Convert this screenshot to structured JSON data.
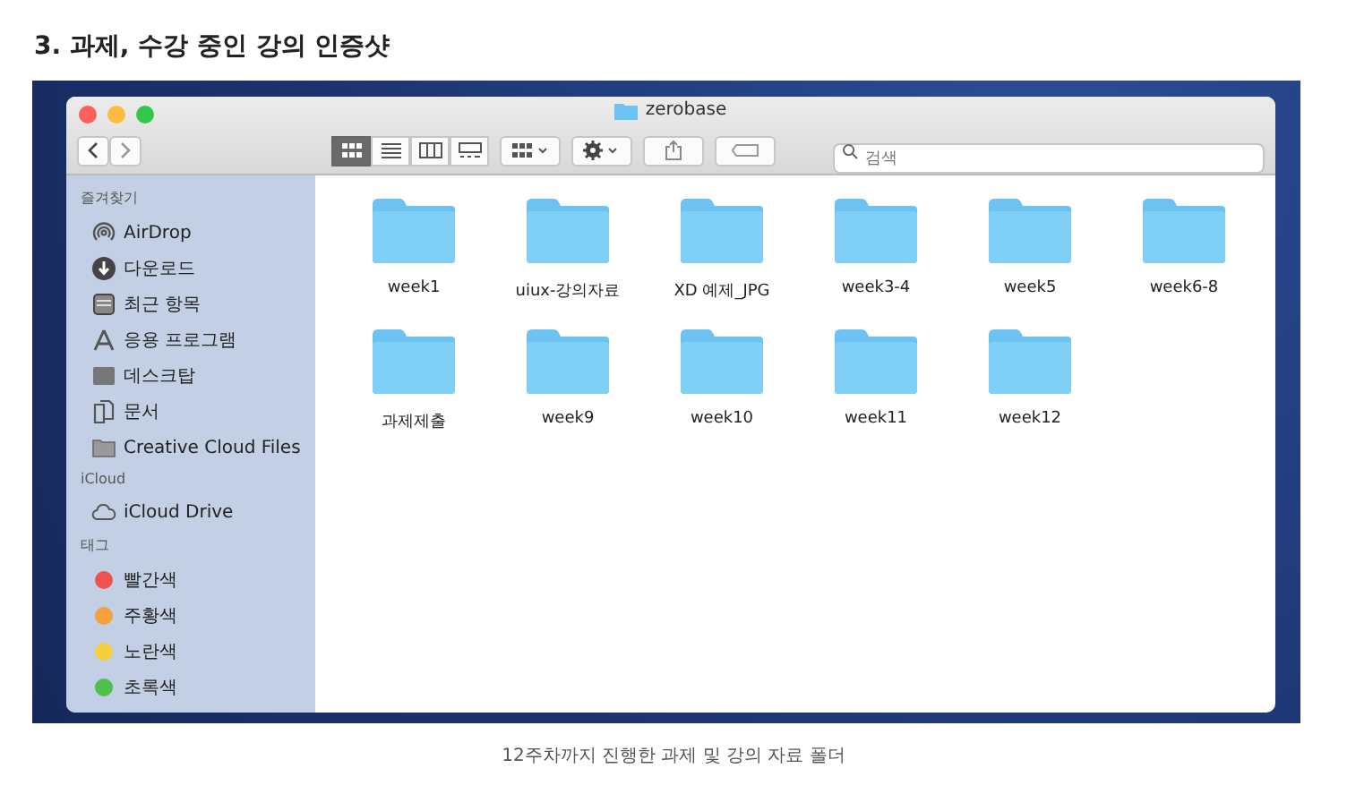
{
  "heading": "3. 과제, 수강 중인 강의 인증샷",
  "window": {
    "title": "zerobase"
  },
  "toolbar": {
    "view_modes": [
      {
        "kind": "icons",
        "selected": true
      },
      {
        "kind": "list",
        "selected": false
      },
      {
        "kind": "columns",
        "selected": false
      },
      {
        "kind": "gallery",
        "selected": false
      }
    ],
    "search": {
      "placeholder": "검색"
    }
  },
  "sidebar": {
    "sections": [
      {
        "title": "즐겨찾기",
        "items": [
          {
            "kind": "airdrop",
            "label": "AirDrop"
          },
          {
            "kind": "download",
            "label": "다운로드"
          },
          {
            "kind": "recent",
            "label": "최근 항목"
          },
          {
            "kind": "apps",
            "label": "응용 프로그램"
          },
          {
            "kind": "desktop",
            "label": "데스크탑"
          },
          {
            "kind": "documents",
            "label": "문서"
          },
          {
            "kind": "folder",
            "label": "Creative Cloud Files"
          }
        ]
      },
      {
        "title": "iCloud",
        "items": [
          {
            "kind": "cloud",
            "label": "iCloud Drive"
          }
        ]
      },
      {
        "title": "태그",
        "items": [
          {
            "kind": "tag",
            "label": "빨간색",
            "color": "#f0524f"
          },
          {
            "kind": "tag",
            "label": "주황색",
            "color": "#f5a03a"
          },
          {
            "kind": "tag",
            "label": "노란색",
            "color": "#f6cf3e"
          },
          {
            "kind": "tag",
            "label": "초록색",
            "color": "#4cc24a"
          }
        ]
      }
    ]
  },
  "folder_rows": [
    [
      "week1",
      "uiux-강의자료",
      "XD 예제_JPG",
      "week3-4",
      "week5",
      "week6-8"
    ],
    [
      "과제제출",
      "week9",
      "week10",
      "week11",
      "week12"
    ]
  ],
  "caption": "12주차까지 진행한 과제 및 강의 자료 폴더"
}
